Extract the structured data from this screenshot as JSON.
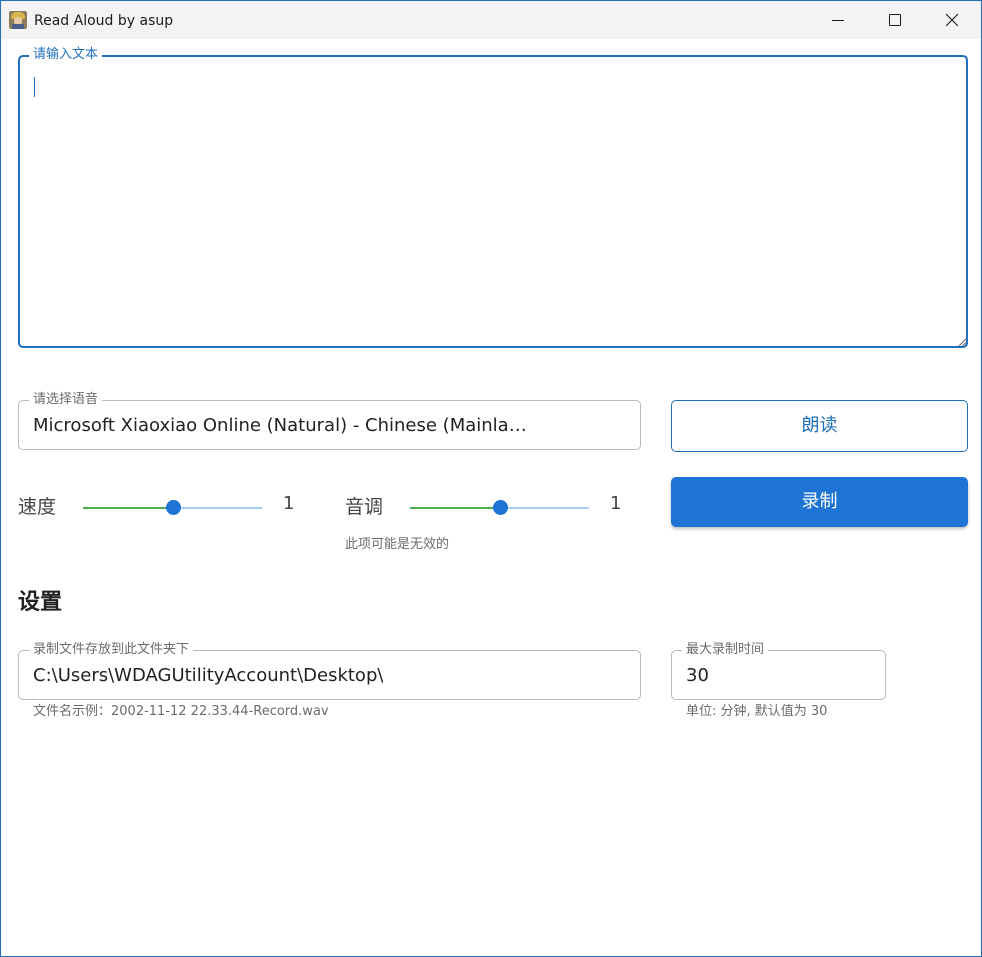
{
  "window": {
    "title": "Read Aloud by asup"
  },
  "text_input": {
    "label": "请输入文本",
    "value": ""
  },
  "voice": {
    "label": "请选择语音",
    "selected": "Microsoft Xiaoxiao Online (Natural) - Chinese (Mainland)"
  },
  "actions": {
    "read_label": "朗读",
    "record_label": "录制"
  },
  "speed": {
    "label": "速度",
    "value": "1",
    "level": 0.5
  },
  "pitch": {
    "label": "音调",
    "value": "1",
    "level": 0.5,
    "note": "此项可能是无效的"
  },
  "settings": {
    "title": "设置",
    "folder": {
      "label": "录制文件存放到此文件夹下",
      "value": "C:\\Users\\WDAGUtilityAccount\\Desktop\\",
      "helper": "文件名示例：2002-11-12 22.33.44-Record.wav"
    },
    "max_time": {
      "label": "最大录制时间",
      "value": "30",
      "helper": "单位: 分钟, 默认值为 30"
    }
  },
  "colors": {
    "accent": "#1e74d4",
    "slider_fill": "#4caf50"
  }
}
